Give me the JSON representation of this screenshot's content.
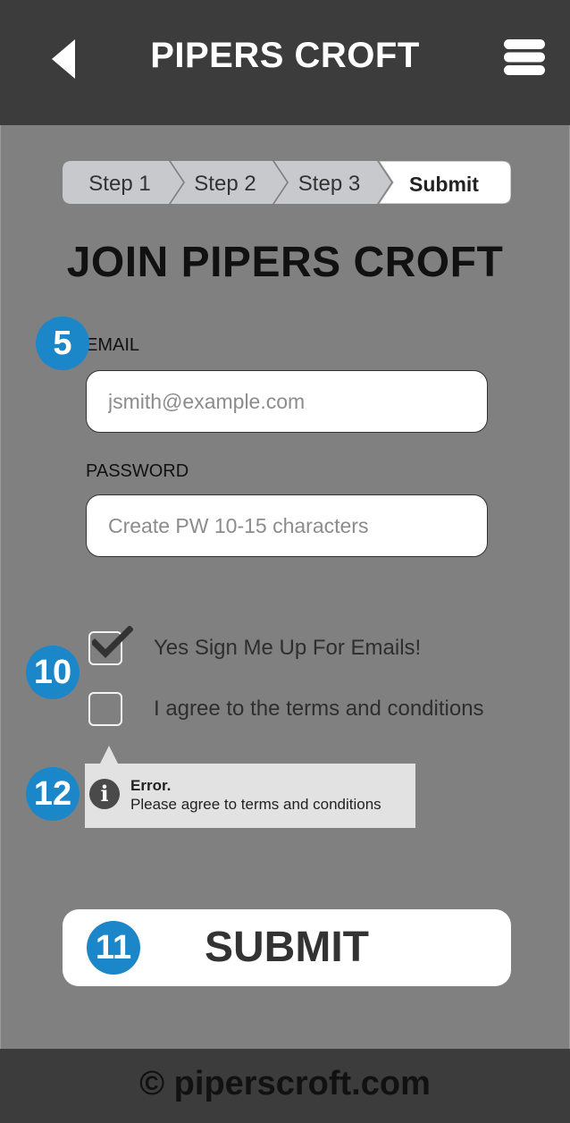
{
  "header": {
    "title": "PIPERS CROFT",
    "back_icon": "chevron-left-icon",
    "menu_icon": "hamburger-menu-icon"
  },
  "steps": {
    "items": [
      {
        "label": "Step 1",
        "state": "inactive"
      },
      {
        "label": "Step 2",
        "state": "inactive"
      },
      {
        "label": "Step 3",
        "state": "inactive"
      },
      {
        "label": "Submit",
        "state": "active"
      }
    ]
  },
  "page": {
    "title": "JOIN PIPERS CROFT"
  },
  "form": {
    "email": {
      "label": "EMAIL",
      "value": "",
      "placeholder": "jsmith@example.com"
    },
    "password": {
      "label": "PASSWORD",
      "value": "",
      "placeholder": "Create PW 10-15 characters"
    },
    "checkboxes": [
      {
        "label": "Yes Sign Me Up For Emails!",
        "checked": true
      },
      {
        "label": "I agree to the terms and conditions",
        "checked": false
      }
    ]
  },
  "error": {
    "title": "Error.",
    "message": "Please agree to terms and conditions",
    "icon": "info-icon"
  },
  "submit": {
    "label": "SUBMIT"
  },
  "annotations": {
    "email": "5",
    "checkboxes": "10",
    "submit": "11",
    "error": "12"
  },
  "footer": {
    "text": "© piperscroft.com"
  },
  "colors": {
    "header_bg": "#3c3c3c",
    "page_bg": "#808080",
    "badge": "#1b87c9",
    "step_inactive": "#c8c9cc",
    "step_active": "#ffffff",
    "error_bg": "#e2e2e2"
  }
}
